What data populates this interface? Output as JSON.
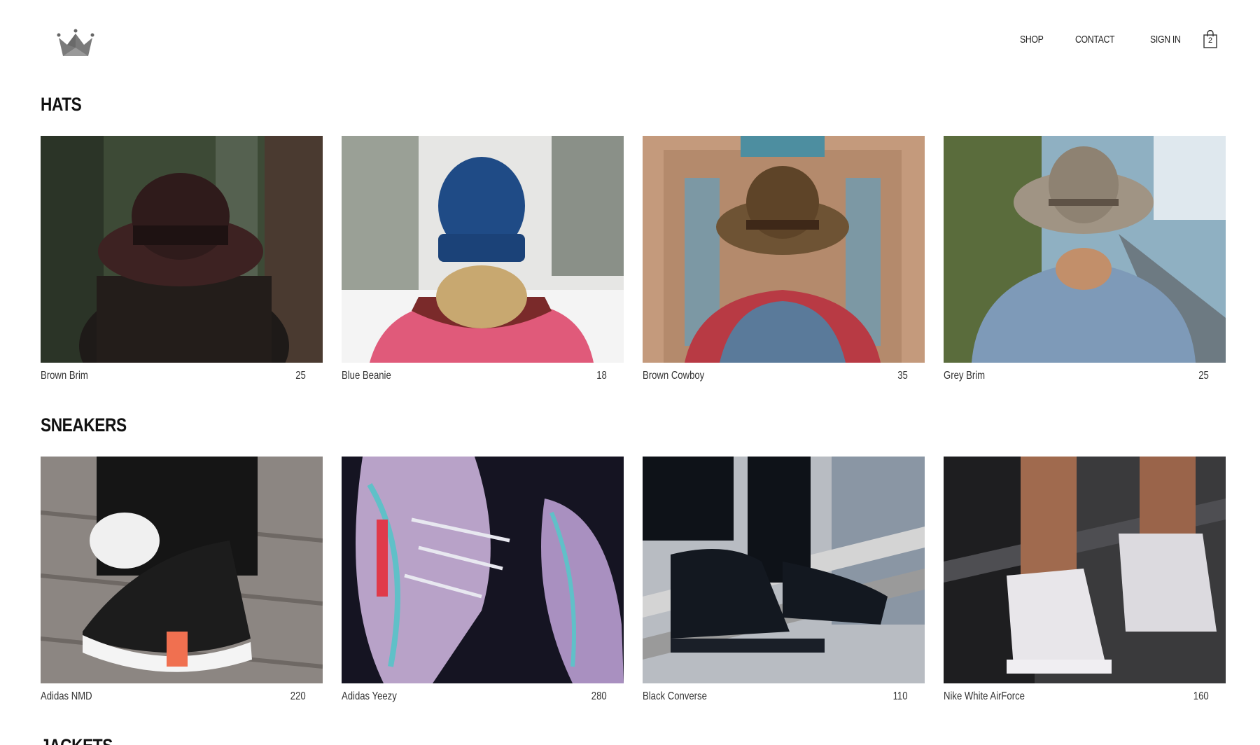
{
  "header": {
    "logo_icon": "crown-icon",
    "nav": [
      {
        "label": "SHOP"
      },
      {
        "label": "CONTACT"
      },
      {
        "label": "SIGN IN"
      }
    ],
    "cart": {
      "icon": "shopping-bag-icon",
      "count": "2"
    }
  },
  "sections": [
    {
      "title": "HATS",
      "items": [
        {
          "name": "Brown Brim",
          "price": "25"
        },
        {
          "name": "Blue Beanie",
          "price": "18"
        },
        {
          "name": "Brown Cowboy",
          "price": "35"
        },
        {
          "name": "Grey Brim",
          "price": "25"
        }
      ]
    },
    {
      "title": "SNEAKERS",
      "items": [
        {
          "name": "Adidas NMD",
          "price": "220"
        },
        {
          "name": "Adidas Yeezy",
          "price": "280"
        },
        {
          "name": "Black Converse",
          "price": "110"
        },
        {
          "name": "Nike White AirForce",
          "price": "160"
        }
      ]
    },
    {
      "title": "JACKETS",
      "items": []
    }
  ]
}
